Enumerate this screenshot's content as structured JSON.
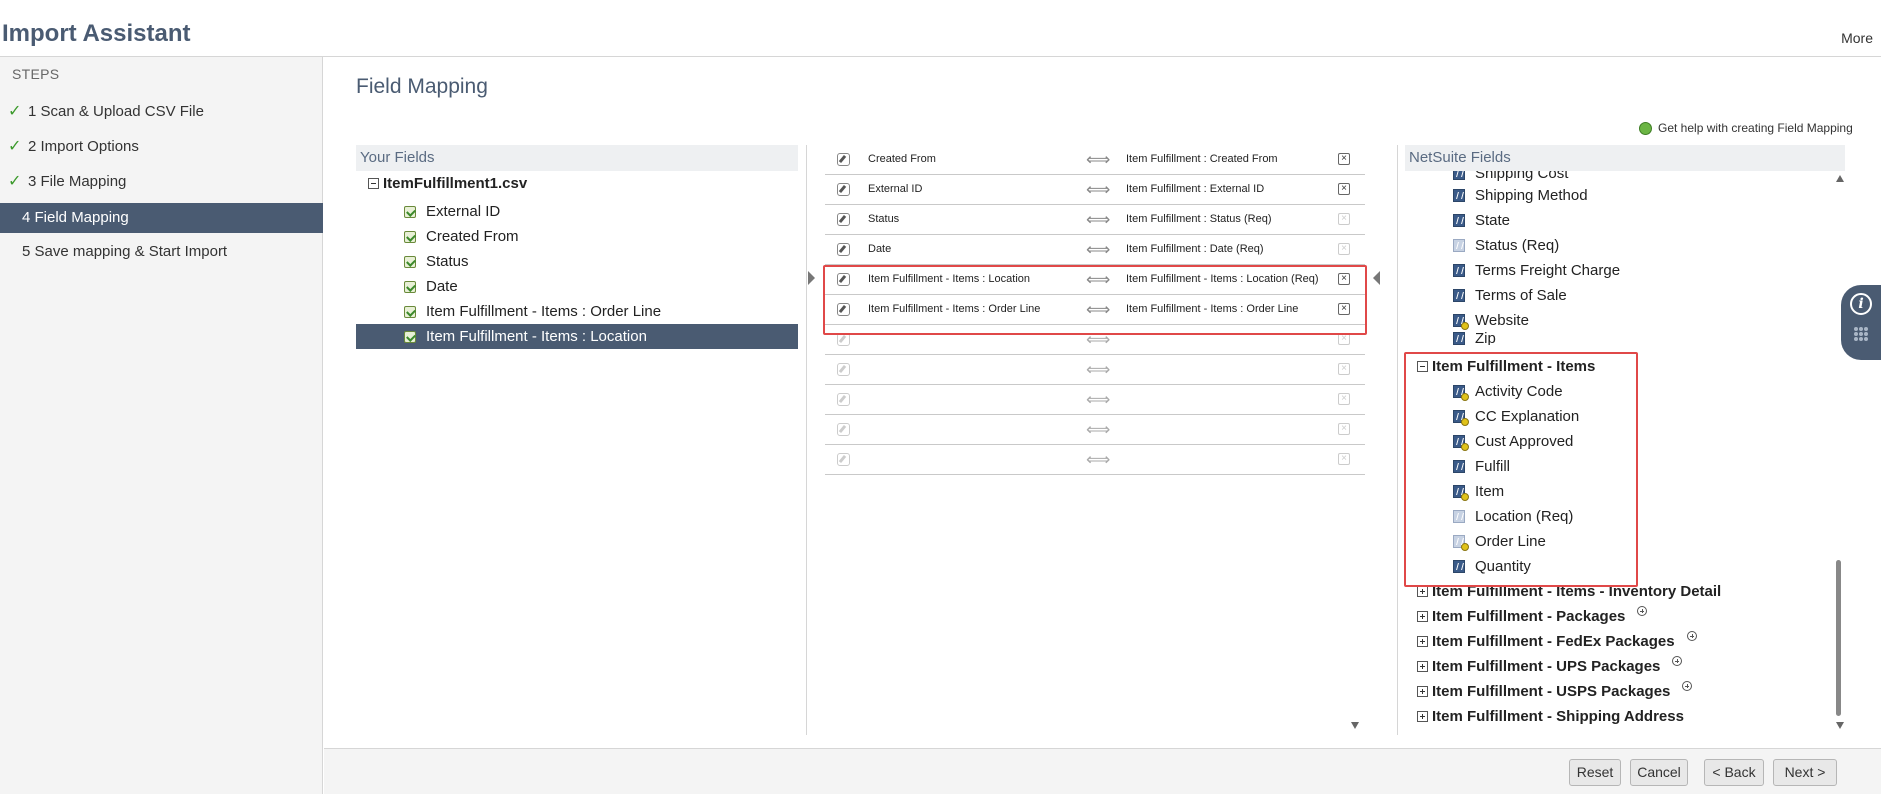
{
  "header": {
    "title": "Import Assistant",
    "more_label": "More"
  },
  "steps": {
    "title": "STEPS",
    "items": [
      {
        "label": "1 Scan & Upload CSV File",
        "done": true
      },
      {
        "label": "2 Import Options",
        "done": true
      },
      {
        "label": "3 File Mapping",
        "done": true
      },
      {
        "label": "4 Field Mapping",
        "active": true
      },
      {
        "label": "5 Save mapping & Start Import"
      }
    ]
  },
  "main": {
    "title": "Field Mapping",
    "help_label": "Get help with creating Field Mapping"
  },
  "your_fields": {
    "header": "Your Fields",
    "file": "ItemFulfillment1.csv",
    "items": [
      "External ID",
      "Created From",
      "Status",
      "Date",
      "Item Fulfillment - Items : Order Line",
      "Item Fulfillment - Items : Location"
    ]
  },
  "mapping": {
    "arrow": "⟺",
    "rows": [
      {
        "src": "Created From",
        "dst": "Item Fulfillment : Created From",
        "removable": true
      },
      {
        "src": "External ID",
        "dst": "Item Fulfillment : External ID",
        "removable": true
      },
      {
        "src": "Status",
        "dst": "Item Fulfillment : Status (Req)",
        "removable": false
      },
      {
        "src": "Date",
        "dst": "Item Fulfillment : Date (Req)",
        "removable": false
      },
      {
        "src": "Item Fulfillment - Items : Location",
        "dst": "Item Fulfillment - Items : Location (Req)",
        "removable": true
      },
      {
        "src": "Item Fulfillment - Items : Order Line",
        "dst": "Item Fulfillment - Items : Order Line",
        "removable": true
      },
      {
        "src": "",
        "dst": ""
      },
      {
        "src": "",
        "dst": ""
      },
      {
        "src": "",
        "dst": ""
      },
      {
        "src": "",
        "dst": ""
      },
      {
        "src": "",
        "dst": ""
      }
    ]
  },
  "netsuite_fields": {
    "header": "NetSuite Fields",
    "top_items": [
      "Shipping Cost",
      "Shipping Method",
      "State",
      "Status (Req)",
      "Terms Freight Charge",
      "Terms of Sale",
      "Website",
      "Zip"
    ],
    "expanded_group": "Item Fulfillment - Items",
    "group_items": [
      "Activity Code",
      "CC Explanation",
      "Cust Approved",
      "Fulfill",
      "Item",
      "Location (Req)",
      "Order Line",
      "Quantity"
    ],
    "collapsed_groups": [
      "Item Fulfillment - Items - Inventory Detail",
      "Item Fulfillment - Packages",
      "Item Fulfillment - FedEx Packages",
      "Item Fulfillment - UPS Packages",
      "Item Fulfillment - USPS Packages",
      "Item Fulfillment - Shipping Address"
    ]
  },
  "footer": {
    "reset": "Reset",
    "cancel": "Cancel",
    "back": "< Back",
    "next": "Next >"
  }
}
